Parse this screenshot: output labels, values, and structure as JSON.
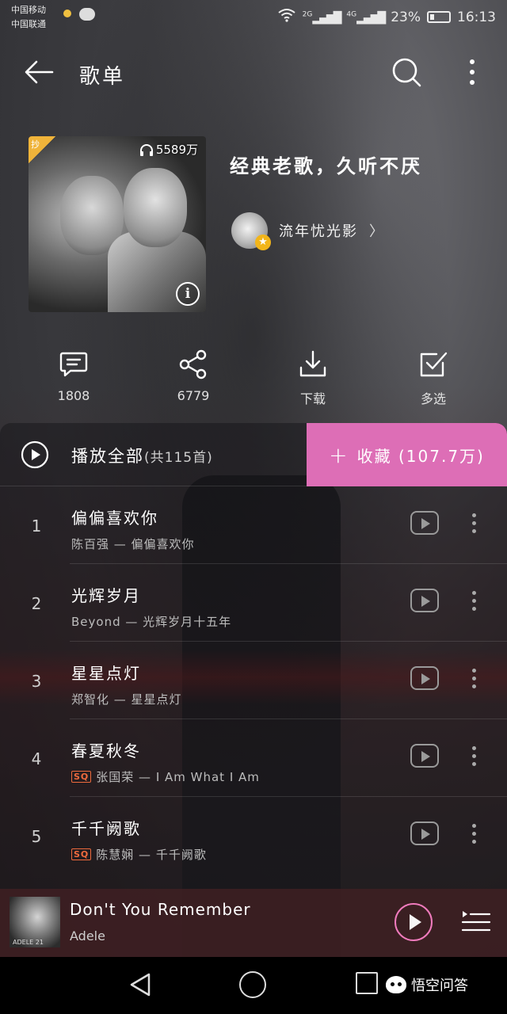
{
  "status_bar": {
    "carrier1": "中国移动",
    "carrier2": "中国联通",
    "net1": "2G",
    "net2": "4G",
    "battery": "23%",
    "time": "16:13"
  },
  "nav": {
    "title": "歌单"
  },
  "playlist": {
    "title": "经典老歌，久听不厌",
    "badge": "抄",
    "play_count": "5589万",
    "creator": "流年忧光影",
    "chevron": "〉"
  },
  "actions": [
    {
      "label": "1808",
      "icon": "comment-icon"
    },
    {
      "label": "6779",
      "icon": "share-icon"
    },
    {
      "label": "下载",
      "icon": "download-icon"
    },
    {
      "label": "多选",
      "icon": "multi-select-icon"
    }
  ],
  "play_all": {
    "label": "播放全部",
    "count": "(共115首)"
  },
  "collect": {
    "plus": "+",
    "label": "收藏 (107.7万)"
  },
  "songs": [
    {
      "index": "1",
      "title": "偏偏喜欢你",
      "sq": "",
      "subtitle": "陈百强 — 偏偏喜欢你"
    },
    {
      "index": "2",
      "title": "光辉岁月",
      "sq": "",
      "subtitle": "Beyond — 光辉岁月十五年"
    },
    {
      "index": "3",
      "title": "星星点灯",
      "sq": "",
      "subtitle": "郑智化 — 星星点灯"
    },
    {
      "index": "4",
      "title": "春夏秋冬",
      "sq": "SQ",
      "subtitle": "张国荣 — I Am What I Am"
    },
    {
      "index": "5",
      "title": "千千阙歌",
      "sq": "SQ",
      "subtitle": "陈慧娴 — 千千阙歌"
    }
  ],
  "mini_player": {
    "title": "Don't You Remember",
    "artist": "Adele",
    "cover_text": "ADELE 21"
  },
  "watermark": {
    "text": "悟空问答"
  },
  "colors": {
    "accent_pink": "#dd6eb6",
    "sq_orange": "#ee6a3d"
  }
}
